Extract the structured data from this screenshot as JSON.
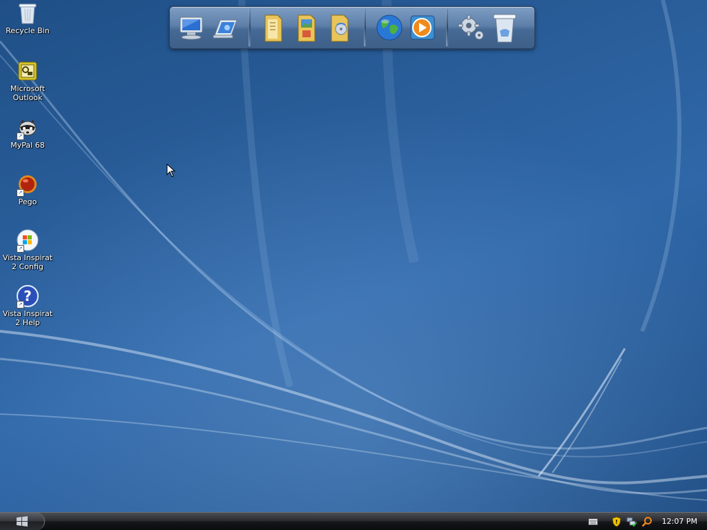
{
  "desktop": {
    "icons": [
      {
        "label": "Recycle Bin"
      },
      {
        "label": "Microsoft\nOutlook"
      },
      {
        "label": "MyPal 68"
      },
      {
        "label": "Pego"
      },
      {
        "label": "Vista Inspirat\n2 Config"
      },
      {
        "label": "Vista Inspirat\n2 Help"
      }
    ]
  },
  "dock": {
    "items": [
      {
        "icon": "computer-icon"
      },
      {
        "icon": "network-icon"
      },
      {
        "icon": "documents-folder-icon"
      },
      {
        "icon": "pictures-folder-icon"
      },
      {
        "icon": "music-folder-icon"
      },
      {
        "icon": "internet-globe-icon"
      },
      {
        "icon": "media-player-icon"
      },
      {
        "icon": "settings-gear-icon"
      },
      {
        "icon": "recycle-bin-icon"
      }
    ]
  },
  "taskbar": {
    "start_icon": "windows-logo-icon",
    "tray_icons": [
      "keyboard-icon",
      "security-shield-icon",
      "network-status-icon",
      "search-icon"
    ],
    "clock": "12:07 PM"
  },
  "colors": {
    "wallpaper": "#2a5f9c",
    "taskbar": "#141518",
    "dock": "#5d7fa9"
  }
}
